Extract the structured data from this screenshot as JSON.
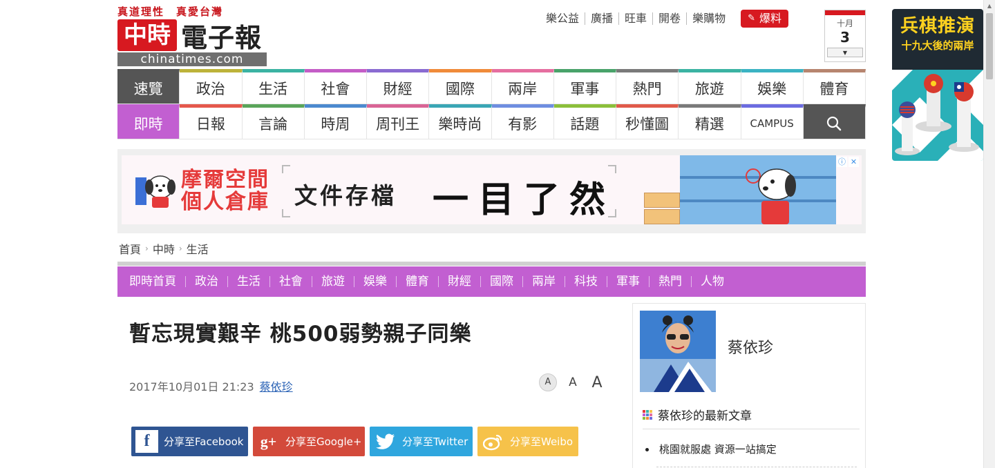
{
  "logo": {
    "slogan": "真道理性　真愛台灣",
    "badge": "中時",
    "name": "電子報",
    "domain": "chinatimes.com"
  },
  "toplinks": [
    "樂公益",
    "廣播",
    "旺車",
    "開卷",
    "樂購物"
  ],
  "baoliao": "爆料",
  "calendar": {
    "month": "十月",
    "day": "3",
    "accent": "#d71920"
  },
  "nav": {
    "row1": [
      "速覽",
      "政治",
      "生活",
      "社會",
      "財經",
      "國際",
      "兩岸",
      "軍事",
      "熱門",
      "旅遊",
      "娛樂",
      "體育"
    ],
    "row2": [
      "即時",
      "日報",
      "言論",
      "時周",
      "周刊王",
      "樂時尚",
      "有影",
      "話題",
      "秒懂圖",
      "精選",
      "CAMPUS"
    ],
    "row1_colors": [
      "#555555",
      "#bdb33a",
      "#3bb3a3",
      "#c45dc7",
      "#8a6bd1",
      "#f08b3a",
      "#e56ea0",
      "#49a36a",
      "#7a7a7a",
      "#3bb3a3",
      "#3bb3c3",
      "#b7856f"
    ],
    "row2_colors": [
      "#c25fd1",
      "#e5584c",
      "#5aa55a",
      "#4c8acf",
      "#d96495",
      "#3aa6b5",
      "#6f8ee0",
      "#8cbf3b",
      "#e05a4a",
      "#7a7a7a",
      "#6c6ce0"
    ],
    "search_icon": "search-icon"
  },
  "ad": {
    "brand_line1": "摩爾空間",
    "brand_line2": "個人倉庫",
    "text1": "文件存檔",
    "text2": "一目了然",
    "info_icon": "ⓘ",
    "close_icon": "✕"
  },
  "breadcrumb": [
    "首頁",
    "中時",
    "生活"
  ],
  "subnav": [
    "即時首頁",
    "政治",
    "生活",
    "社會",
    "旅遊",
    "娛樂",
    "體育",
    "財經",
    "國際",
    "兩岸",
    "科技",
    "軍事",
    "熱門",
    "人物"
  ],
  "article": {
    "title": "暫忘現實艱辛 桃500弱勢親子同樂",
    "datetime": "2017年10月01日 21:23",
    "author": "蔡依珍",
    "font_sizes": [
      "A",
      "A",
      "A"
    ]
  },
  "share": {
    "facebook": "分享至Facebook",
    "google": "分享至Google+",
    "twitter": "分享至Twitter",
    "weibo": "分享至Weibo",
    "fb_glyph": "f",
    "gp_glyph": "g+"
  },
  "sidebar": {
    "name": "蔡依珍",
    "heading": "蔡依珍的最新文章",
    "articles": [
      "桃園就服處 資源一站搞定"
    ]
  },
  "promo": {
    "line1": "兵棋推演",
    "line2": "十九大後的兩岸"
  }
}
